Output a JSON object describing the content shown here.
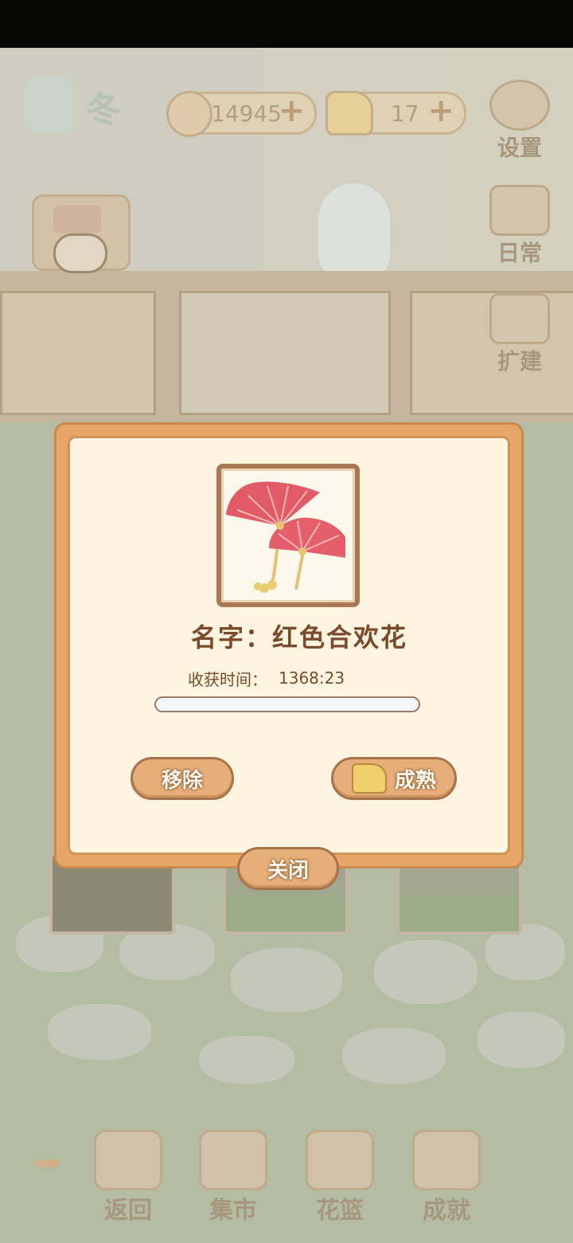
{
  "hud": {
    "season_label": "冬",
    "currency_fish": "14945",
    "currency_cheese": "17",
    "fish_icon": "fish-bone-icon",
    "cheese_icon": "cheese-icon"
  },
  "side_menu": {
    "settings": "设置",
    "daily": "日常",
    "expand": "扩建"
  },
  "bottom_nav": {
    "back": "返回",
    "market": "集市",
    "basket": "花篮",
    "achievement": "成就"
  },
  "dialog": {
    "name_label": "名字：",
    "flower_name": "红色合欢花",
    "harvest_label": "收获时间：",
    "harvest_time": "1368:23",
    "progress": 0.0,
    "remove_button": "移除",
    "mature_button": "成熟",
    "close_button": "关闭"
  },
  "colors": {
    "dialog_border": "#e7a668",
    "dialog_bg": "#fdf5df",
    "button_fill": "#e6ae78",
    "text_brown": "#7a4a2c"
  }
}
